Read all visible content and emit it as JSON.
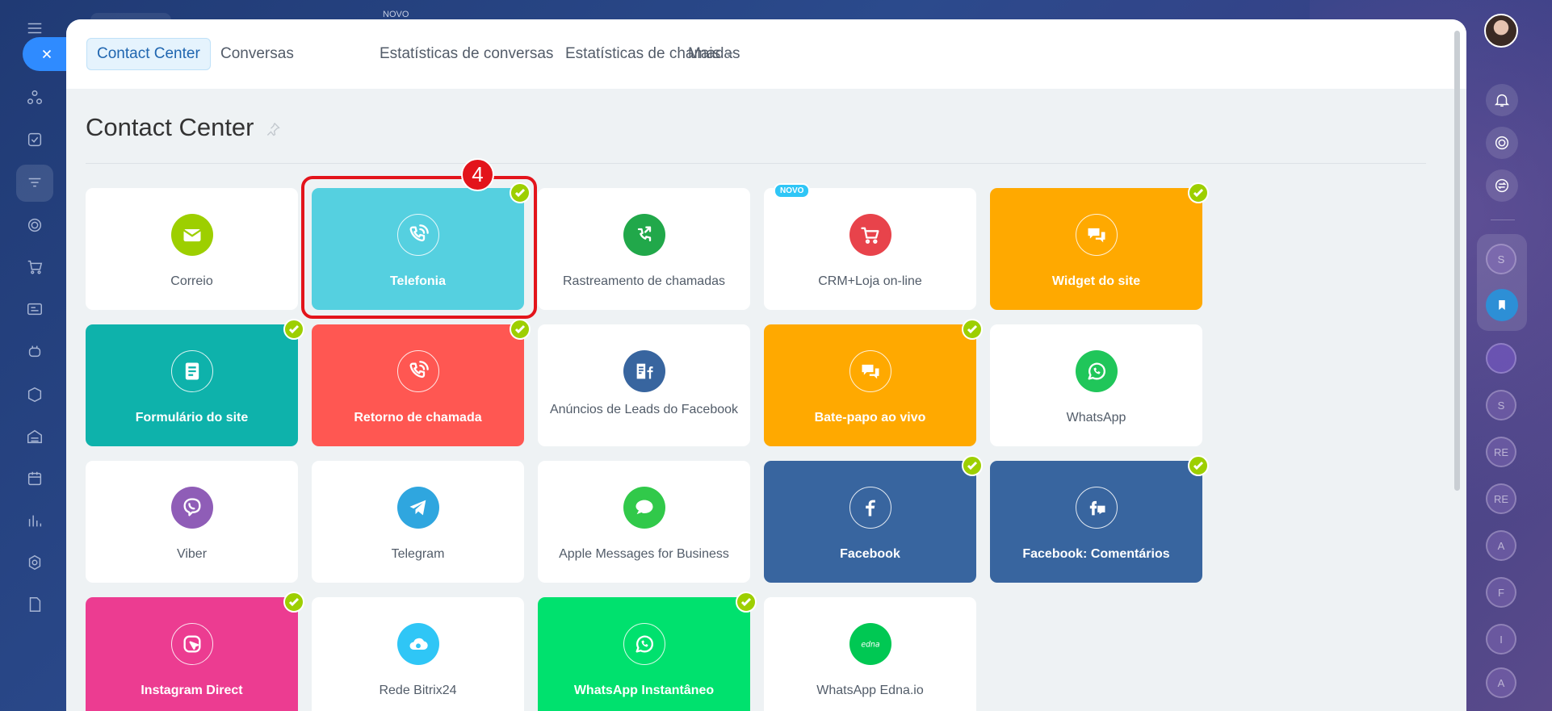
{
  "window": {
    "top_badge": "NOVO"
  },
  "nav": {
    "tabs": [
      {
        "label": "Contact Center",
        "active": true
      },
      {
        "label": "Conversas"
      },
      {
        "label": "Estatísticas de conversas"
      },
      {
        "label": "Estatísticas de chamadas"
      },
      {
        "label": "Mais"
      }
    ]
  },
  "page": {
    "title": "Contact Center"
  },
  "annotation": {
    "step": "4"
  },
  "tiles": [
    {
      "label": "Correio",
      "icon": "mail-icon",
      "bg": "#ffffff",
      "icon_bg": "#9dcf00",
      "connected": false
    },
    {
      "label": "Telefonia",
      "icon": "phone-icon",
      "bg": "#55d0e0",
      "connected": true
    },
    {
      "label": "Rastreamento de chamadas",
      "icon": "call-tracking-icon",
      "bg": "#ffffff",
      "icon_bg": "#21a84a",
      "connected": false
    },
    {
      "label": "CRM+Loja on-line",
      "icon": "shop-cart-icon",
      "bg": "#ffffff",
      "icon_bg": "#e8434b",
      "connected": false,
      "badge": "NOVO"
    },
    {
      "label": "Widget do site",
      "icon": "chat-bubbles-icon",
      "bg": "#ffa900",
      "connected": true
    },
    {
      "label": "Formulário do site",
      "icon": "form-icon",
      "bg": "#0eb2ab",
      "connected": true
    },
    {
      "label": "Retorno de chamada",
      "icon": "callback-icon",
      "bg": "#ff5752",
      "connected": true
    },
    {
      "label": "Anúncios de Leads do Facebook",
      "icon": "facebook-leads-icon",
      "bg": "#ffffff",
      "icon_bg": "#38659f",
      "connected": false
    },
    {
      "label": "Bate-papo ao vivo",
      "icon": "live-chat-icon",
      "bg": "#ffa900",
      "connected": true
    },
    {
      "label": "WhatsApp",
      "icon": "whatsapp-icon",
      "bg": "#ffffff",
      "icon_bg": "#20c65a",
      "connected": false
    },
    {
      "label": "Viber",
      "icon": "viber-icon",
      "bg": "#ffffff",
      "icon_bg": "#8f5db7",
      "connected": false
    },
    {
      "label": "Telegram",
      "icon": "telegram-icon",
      "bg": "#ffffff",
      "icon_bg": "#2fa6df",
      "connected": false
    },
    {
      "label": "Apple Messages for Business",
      "icon": "apple-messages-icon",
      "bg": "#ffffff",
      "icon_bg": "#31c94a",
      "connected": false
    },
    {
      "label": "Facebook",
      "icon": "facebook-icon",
      "bg": "#38659f",
      "connected": true
    },
    {
      "label": "Facebook: Comentários",
      "icon": "facebook-comments-icon",
      "bg": "#38659f",
      "connected": true
    },
    {
      "label": "Instagram Direct",
      "icon": "instagram-direct-icon",
      "bg": "#ec3c91",
      "connected": true
    },
    {
      "label": "Rede Bitrix24",
      "icon": "bitrix-cloud-icon",
      "bg": "#ffffff",
      "icon_bg": "#2fc6f6",
      "connected": false
    },
    {
      "label": "WhatsApp Instantâneo",
      "icon": "whatsapp-icon",
      "bg": "#00e16e",
      "connected": true
    },
    {
      "label": "WhatsApp Edna.io",
      "icon": "edna-icon",
      "bg": "#ffffff",
      "icon_bg": "#00c853",
      "connected": false
    }
  ],
  "right_rail": {
    "circles": [
      "S",
      "S",
      "RE",
      "RE",
      "A",
      "F",
      "I",
      "A"
    ]
  }
}
